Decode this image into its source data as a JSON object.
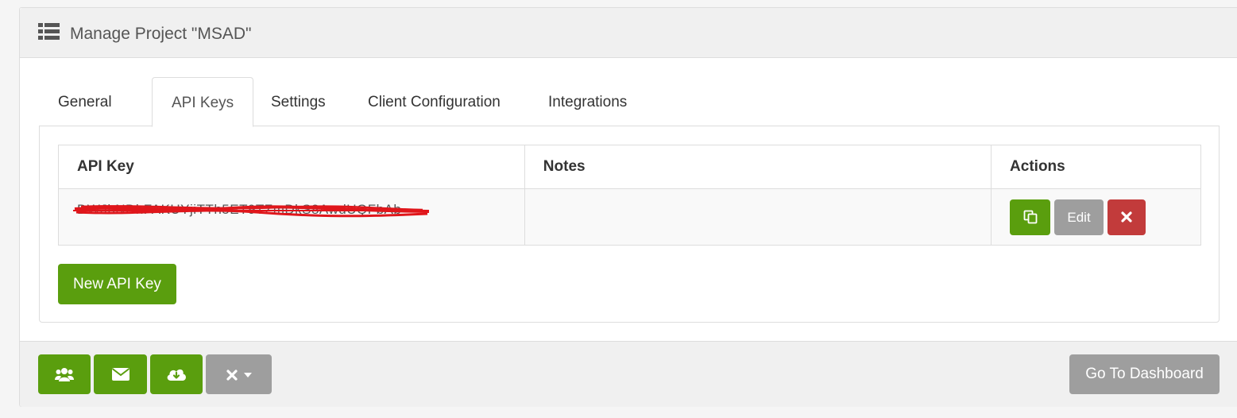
{
  "header": {
    "title": "Manage Project \"MSAD\"",
    "icon": "list-icon"
  },
  "tabs": [
    {
      "label": "General",
      "active": false
    },
    {
      "label": "API Keys",
      "active": true
    },
    {
      "label": "Settings",
      "active": false
    },
    {
      "label": "Client Configuration",
      "active": false
    },
    {
      "label": "Integrations",
      "active": false
    }
  ],
  "table": {
    "columns": [
      "API Key",
      "Notes",
      "Actions"
    ],
    "rows": [
      {
        "api_key": "DWJbNDhFAKUYjiTTh5ET9TZmDkS8AwdUQFbAb",
        "api_key_redacted": true,
        "notes": "",
        "actions": {
          "copy_icon": "copy-icon",
          "edit_label": "Edit",
          "delete_icon": "times-icon"
        }
      }
    ]
  },
  "new_key_button": "New API Key",
  "footer": {
    "buttons": [
      {
        "icon": "users-icon"
      },
      {
        "icon": "envelope-icon"
      },
      {
        "icon": "cloud-download-icon"
      },
      {
        "icon": "times-icon",
        "caret": "caret-down-icon"
      }
    ],
    "dashboard_label": "Go To Dashboard"
  },
  "colors": {
    "primary_green": "#5a9e0e",
    "grey": "#9e9e9e",
    "danger": "#c23b3b",
    "redaction": "#e0161b"
  }
}
